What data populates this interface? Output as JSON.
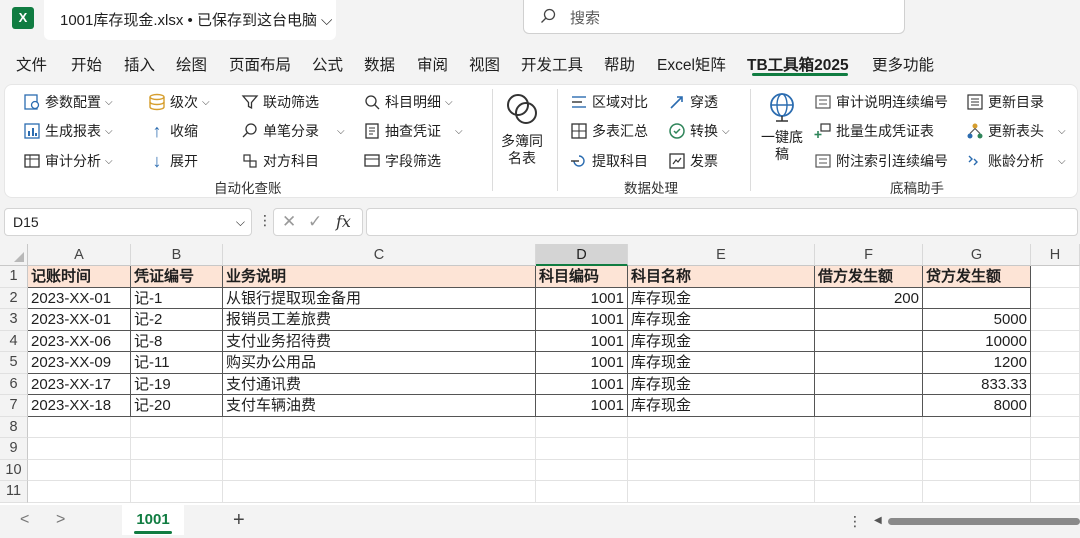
{
  "window": {
    "app_icon": "X",
    "file_title": "1001库存现金.xlsx • 已保存到这台电脑",
    "search_placeholder": "搜索"
  },
  "menu": {
    "tabs": [
      {
        "label": "文件"
      },
      {
        "label": "开始"
      },
      {
        "label": "插入"
      },
      {
        "label": "绘图"
      },
      {
        "label": "页面布局"
      },
      {
        "label": "公式"
      },
      {
        "label": "数据"
      },
      {
        "label": "审阅"
      },
      {
        "label": "视图"
      },
      {
        "label": "开发工具"
      },
      {
        "label": "帮助"
      },
      {
        "label": "Excel矩阵"
      },
      {
        "label": "TB工具箱2025"
      },
      {
        "label": "更多功能"
      }
    ],
    "active": "TB工具箱2025"
  },
  "ribbon": {
    "automation": {
      "label": "自动化查账",
      "params": "参数配置",
      "report": "生成报表",
      "audit": "审计分析",
      "level": "级次",
      "collapse": "收缩",
      "expand": "展开",
      "linked_filter": "联动筛选",
      "single_entry": "单笔分录",
      "counter": "对方科目",
      "subject_detail": "科目明细",
      "sample": "抽查凭证",
      "field_filter": "字段筛选"
    },
    "multi_book": "多簿同名表",
    "data": {
      "label": "数据处理",
      "region": "区域对比",
      "multi_sum": "多表汇总",
      "extract": "提取科目",
      "penetrate": "穿透",
      "convert": "转换",
      "invoice": "发票"
    },
    "draft": {
      "label": "底稿助手",
      "one_key": "一键底稿",
      "audit_note": "审计说明连续编号",
      "batch_voucher": "批量生成凭证表",
      "annot_index": "附注索引连续编号",
      "update_toc": "更新目录",
      "update_header": "更新表头",
      "aging": "账龄分析"
    }
  },
  "formula_bar": {
    "namebox": "D15",
    "cancel": "✕",
    "enter": "✓",
    "fx": "fx",
    "formula": ""
  },
  "sheet": {
    "columns": [
      "A",
      "B",
      "C",
      "D",
      "E",
      "F",
      "G",
      "H"
    ],
    "row_numbers": [
      "1",
      "2",
      "3",
      "4",
      "5",
      "6",
      "7",
      "8",
      "9",
      "10",
      "11"
    ],
    "header": [
      "记账时间",
      "凭证编号",
      "业务说明",
      "科目编码",
      "科目名称",
      "借方发生额",
      "贷方发生额"
    ],
    "rows": [
      [
        "2023-XX-01",
        "记-1",
        "从银行提取现金备用",
        "1001",
        "库存现金",
        "200",
        ""
      ],
      [
        "2023-XX-01",
        "记-2",
        "报销员工差旅费",
        "1001",
        "库存现金",
        "",
        "5000"
      ],
      [
        "2023-XX-06",
        "记-8",
        "支付业务招待费",
        "1001",
        "库存现金",
        "",
        "10000"
      ],
      [
        "2023-XX-09",
        "记-11",
        "购买办公用品",
        "1001",
        "库存现金",
        "",
        "1200"
      ],
      [
        "2023-XX-17",
        "记-19",
        "支付通讯费",
        "1001",
        "库存现金",
        "",
        "833.33"
      ],
      [
        "2023-XX-18",
        "记-20",
        "支付车辆油费",
        "1001",
        "库存现金",
        "",
        "8000"
      ]
    ],
    "selected_column": "D",
    "tab_name": "1001",
    "add_sheet": "+"
  },
  "colors": {
    "accent": "#107c41",
    "header_fill": "#fde4d6"
  }
}
